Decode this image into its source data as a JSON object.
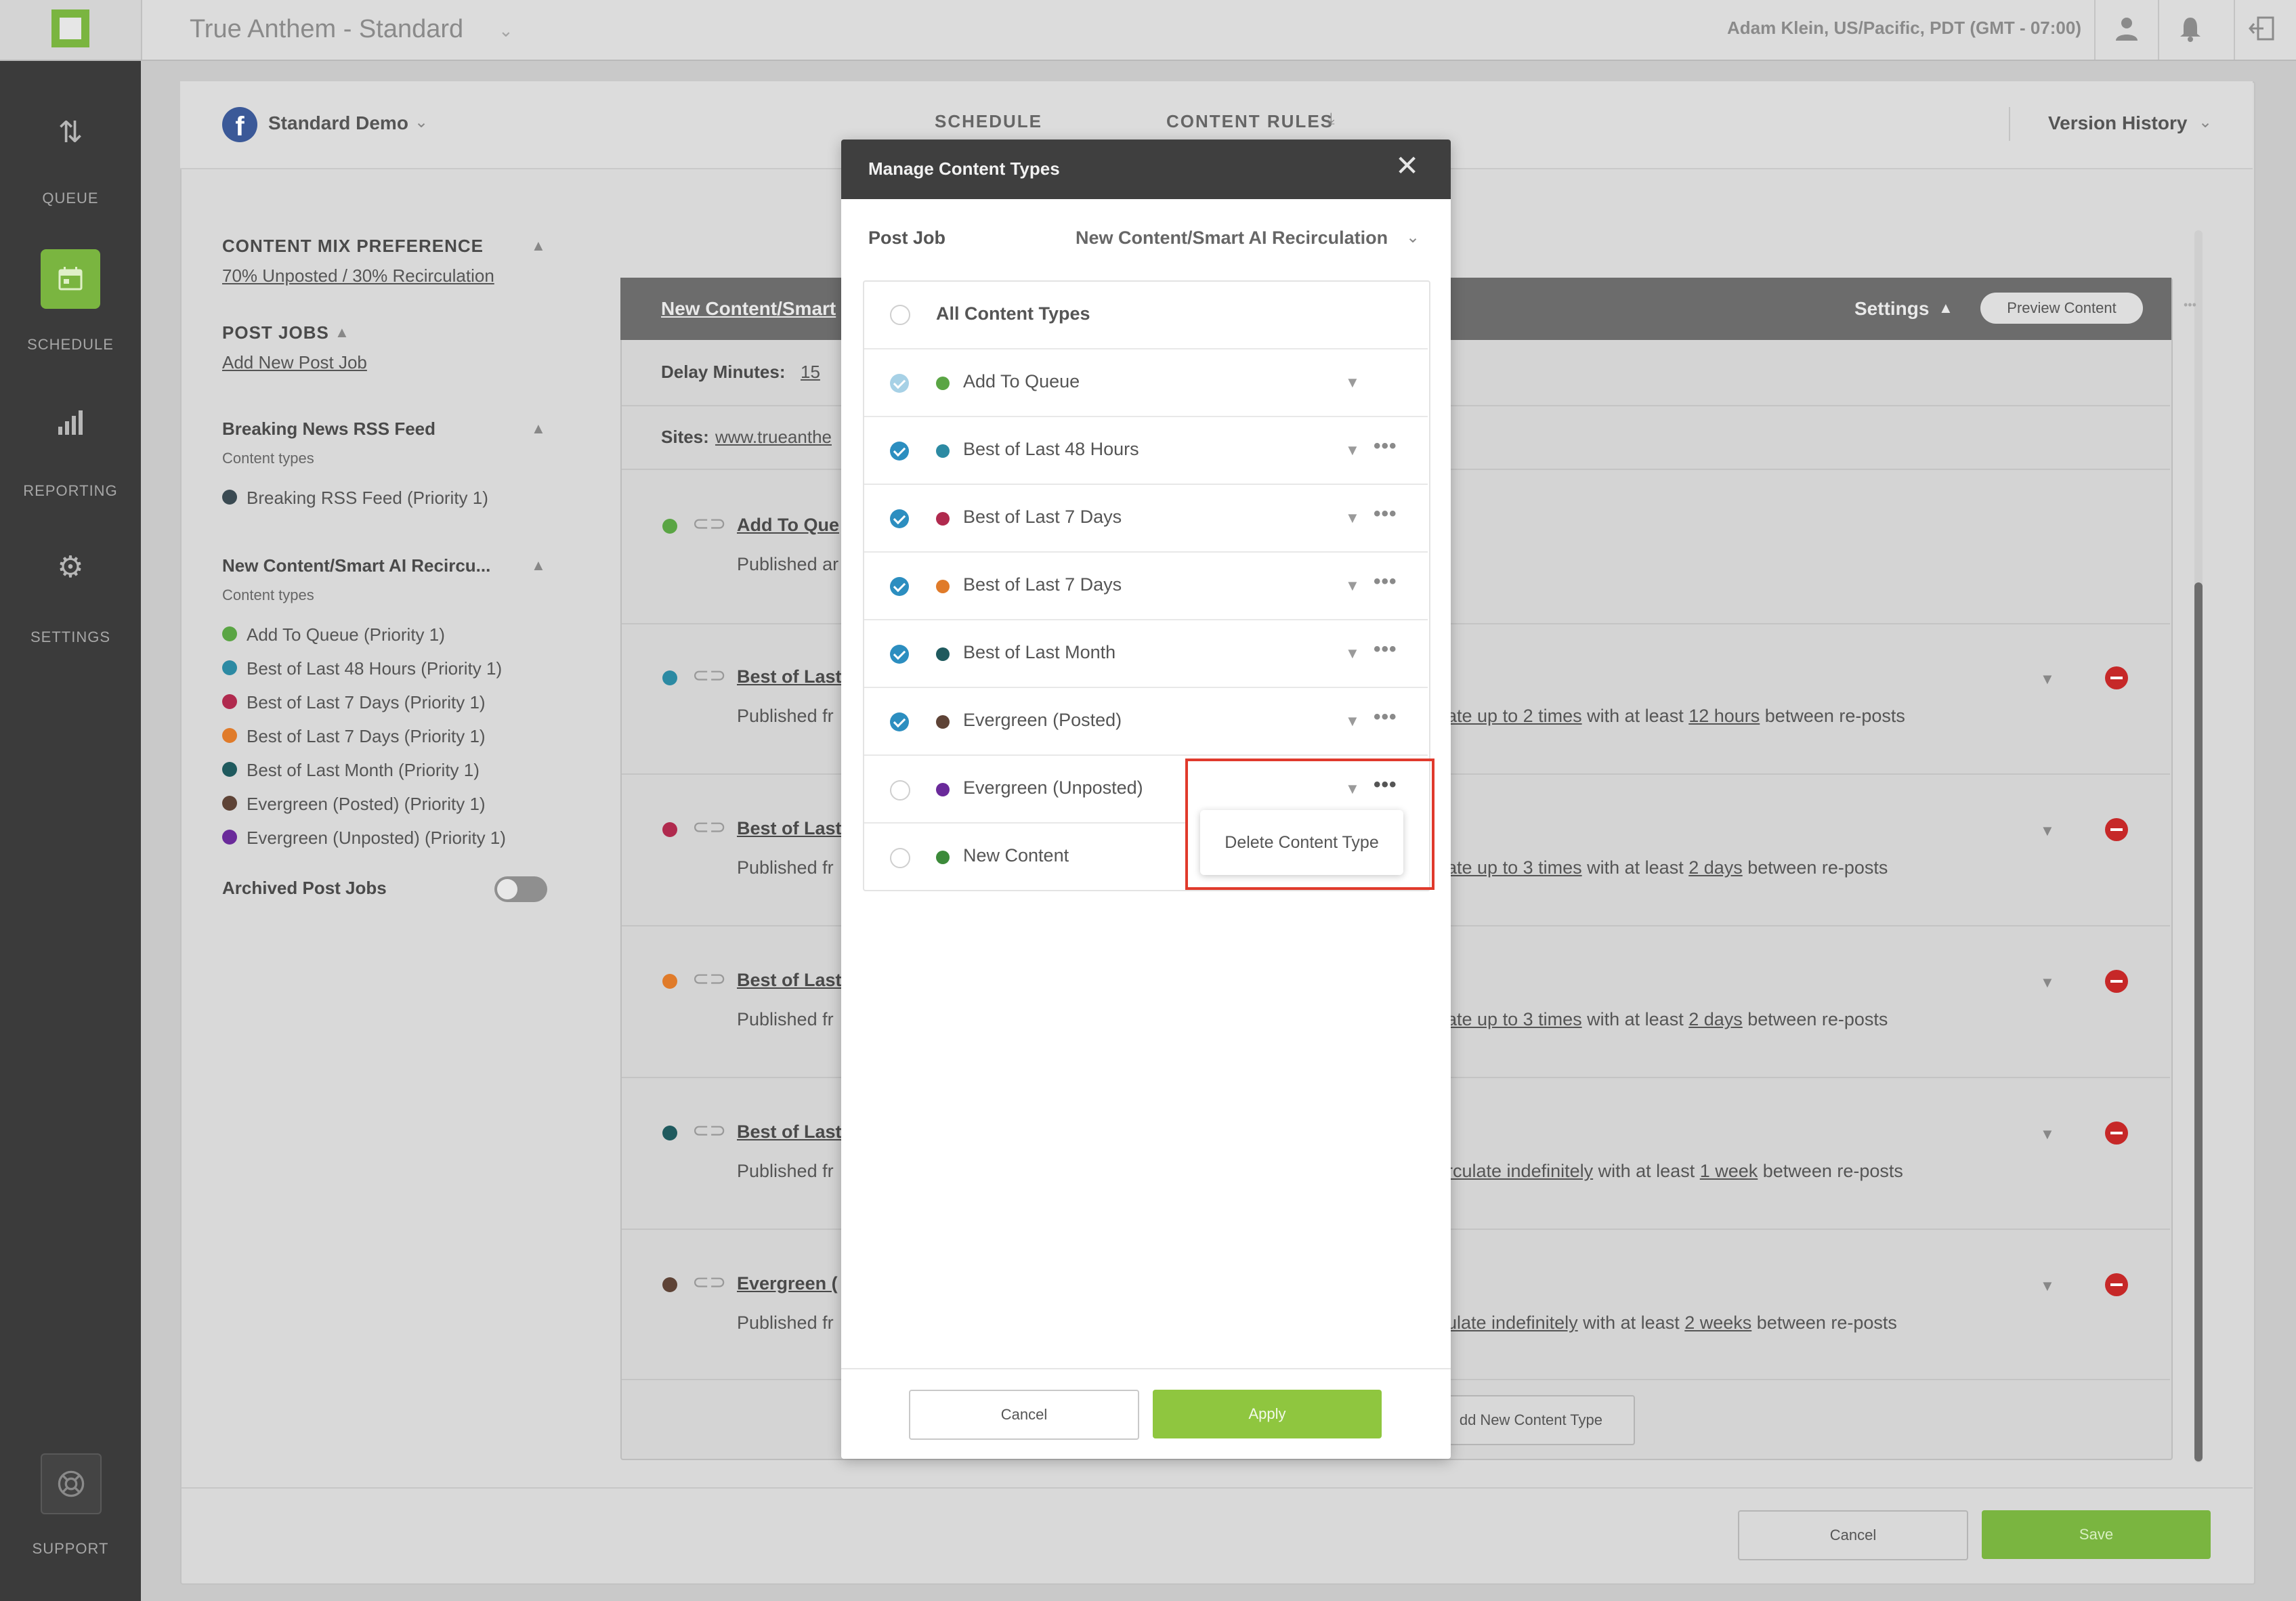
{
  "app": {
    "title": "True Anthem - Standard",
    "user_info": "Adam Klein, US/Pacific, PDT (GMT - 07:00)"
  },
  "nav": {
    "items": [
      {
        "label": "QUEUE",
        "icon": "sort-arrows-icon"
      },
      {
        "label": "SCHEDULE",
        "icon": "calendar-icon"
      },
      {
        "label": "REPORTING",
        "icon": "bar-chart-icon"
      },
      {
        "label": "SETTINGS",
        "icon": "gear-icon"
      },
      {
        "label": "SUPPORT",
        "icon": "lifebuoy-icon"
      }
    ]
  },
  "header": {
    "account": "Standard Demo",
    "tabs": [
      "SCHEDULE",
      "CONTENT RULES"
    ],
    "version_history": "Version History"
  },
  "left_panel": {
    "mix_title": "CONTENT MIX PREFERENCE",
    "mix_value": "70% Unposted / 30% Recirculation",
    "post_jobs_title": "POST JOBS",
    "add_post_job": "Add New Post Job",
    "jobs": [
      {
        "name": "Breaking News RSS Feed",
        "sub": "Content types",
        "items": [
          {
            "label": "Breaking RSS Feed (Priority 1)",
            "color": "#3a4a52"
          }
        ]
      },
      {
        "name": "New Content/Smart AI Recircu...",
        "sub": "Content types",
        "items": [
          {
            "label": "Add To Queue (Priority 1)",
            "color": "#5aa544"
          },
          {
            "label": "Best of Last 48 Hours (Priority 1)",
            "color": "#2c8aa3"
          },
          {
            "label": "Best of Last 7 Days (Priority 1)",
            "color": "#b02a4e"
          },
          {
            "label": "Best of Last 7 Days (Priority 1)",
            "color": "#e07b2a"
          },
          {
            "label": "Best of Last Month (Priority 1)",
            "color": "#1f5a5e"
          },
          {
            "label": "Evergreen (Posted) (Priority 1)",
            "color": "#5e4336"
          },
          {
            "label": "Evergreen (Unposted) (Priority 1)",
            "color": "#6a2a9a"
          }
        ]
      }
    ],
    "archived": "Archived Post Jobs"
  },
  "post_job_panel": {
    "title": "New Content/Smart",
    "settings": "Settings",
    "preview": "Preview Content",
    "delay_label": "Delay Minutes:",
    "delay_value": "15",
    "sites_label": "Sites:",
    "sites_value": "www.trueanthe",
    "content_types": [
      {
        "name": "Add To Que",
        "pub": "Published ar",
        "color": "#5aa544",
        "rule_pre": "",
        "rule_a": "",
        "rule_mid": "",
        "rule_b": "",
        "rule_post": ""
      },
      {
        "name": "Best of Last",
        "pub": "Published fr",
        "color": "#2c8aa3",
        "rule_pre": "",
        "rule_a": "ate up to 2 times",
        "rule_mid": " with at least ",
        "rule_b": "12 hours",
        "rule_post": " between re-posts"
      },
      {
        "name": "Best of Last",
        "pub": "Published fr",
        "color": "#b02a4e",
        "rule_pre": "",
        "rule_a": "ate up to 3 times",
        "rule_mid": " with at least ",
        "rule_b": "2 days",
        "rule_post": " between re-posts"
      },
      {
        "name": "Best of Last",
        "pub": "Published fr",
        "color": "#e07b2a",
        "rule_pre": "",
        "rule_a": "ate up to 3 times",
        "rule_mid": " with at least ",
        "rule_b": "2 days",
        "rule_post": " between re-posts"
      },
      {
        "name": "Best of Last",
        "pub": "Published fr",
        "color": "#1f5a5e",
        "rule_pre": "",
        "rule_a": "rculate indefinitely",
        "rule_mid": " with at least ",
        "rule_b": "1 week",
        "rule_post": " between re-posts"
      },
      {
        "name": "Evergreen (",
        "pub": "Published fr",
        "color": "#5e4336",
        "rule_pre": "",
        "rule_a": "ulate indefinitely",
        "rule_mid": " with at least ",
        "rule_b": "2 weeks",
        "rule_post": " between re-posts"
      }
    ],
    "add_content_type": "dd New Content Type"
  },
  "footer": {
    "cancel": "Cancel",
    "save": "Save"
  },
  "modal": {
    "title": "Manage Content Types",
    "post_job_label": "Post Job",
    "post_job_value": "New Content/Smart AI Recirculation",
    "all_types": "All Content Types",
    "items": [
      {
        "name": "Add To Queue",
        "color": "#5aa544",
        "state": "checked-light",
        "more": false
      },
      {
        "name": "Best of Last 48 Hours",
        "color": "#2c8aa3",
        "state": "checked",
        "more": true
      },
      {
        "name": "Best of Last 7 Days",
        "color": "#b02a4e",
        "state": "checked",
        "more": true
      },
      {
        "name": "Best of Last 7 Days",
        "color": "#e07b2a",
        "state": "checked",
        "more": true
      },
      {
        "name": "Best of Last Month",
        "color": "#1f5a5e",
        "state": "checked",
        "more": true
      },
      {
        "name": "Evergreen (Posted)",
        "color": "#5e4336",
        "state": "checked",
        "more": true
      },
      {
        "name": "Evergreen (Unposted)",
        "color": "#6a2a9a",
        "state": "unchecked",
        "more": true
      },
      {
        "name": "New Content",
        "color": "#3c8a3a",
        "state": "unchecked",
        "more": false
      }
    ],
    "popover": "Delete Content Type",
    "cancel": "Cancel",
    "apply": "Apply"
  }
}
